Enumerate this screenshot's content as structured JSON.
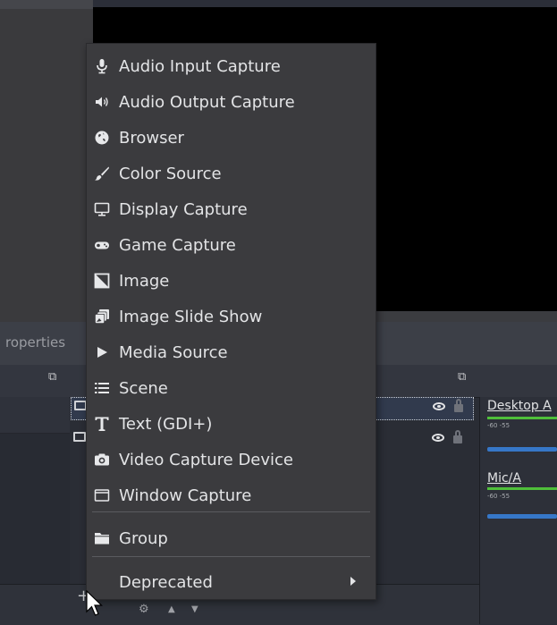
{
  "properties_dock": {
    "label": "roperties"
  },
  "context_menu": {
    "items": [
      {
        "label": "Audio Input Capture",
        "icon": "microphone-icon"
      },
      {
        "label": "Audio Output Capture",
        "icon": "speaker-icon"
      },
      {
        "label": "Browser",
        "icon": "globe-icon"
      },
      {
        "label": "Color Source",
        "icon": "paintbrush-icon"
      },
      {
        "label": "Display Capture",
        "icon": "monitor-icon"
      },
      {
        "label": "Game Capture",
        "icon": "gamepad-icon"
      },
      {
        "label": "Image",
        "icon": "image-icon"
      },
      {
        "label": "Image Slide Show",
        "icon": "slideshow-icon"
      },
      {
        "label": "Media Source",
        "icon": "play-icon"
      },
      {
        "label": "Scene",
        "icon": "list-icon"
      },
      {
        "label": "Text (GDI+)",
        "icon": "text-icon"
      },
      {
        "label": "Video Capture Device",
        "icon": "camera-icon"
      },
      {
        "label": "Window Capture",
        "icon": "window-icon"
      }
    ],
    "group": {
      "label": "Group",
      "icon": "folder-icon"
    },
    "deprecated": {
      "label": "Deprecated",
      "has_submenu": true
    }
  },
  "audio_mixer": {
    "channels": [
      {
        "label": "Desktop A",
        "ticks": "-60   -55"
      },
      {
        "label": "Mic/A",
        "ticks": "-60   -55"
      }
    ]
  },
  "colors": {
    "menu_bg": "#3b3b3e",
    "meter_green": "#4fbf3a",
    "meter_blue": "#3677c8",
    "selection": "#313a4d"
  }
}
